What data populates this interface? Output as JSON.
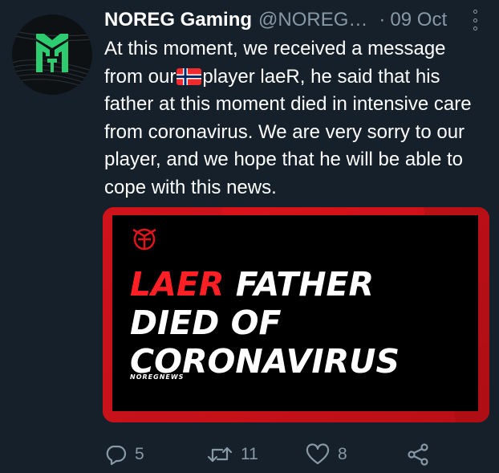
{
  "tweet": {
    "author_name": "NOREG Gaming",
    "handle": "@NOREG…",
    "separator": "·",
    "date": "09 Oct",
    "text_before_flag": "At this moment, we received a message from our",
    "flag_icon": "norway-flag-icon",
    "text_after_flag": "player laeR, he said that his father at this moment died in intensive care from coronavirus. We are very sorry to our player, and we hope that he will be able to cope with this news."
  },
  "media": {
    "headline_red": "LAER",
    "headline_line1": "FATHER",
    "headline_line2": "DIED OF",
    "headline_line3": "CORONAVIRUS",
    "tag": "NOREGNEWS"
  },
  "actions": {
    "reply_count": "5",
    "retweet_count": "11",
    "like_count": "8"
  },
  "icons": {
    "reply": "reply-icon",
    "retweet": "retweet-icon",
    "like": "heart-icon",
    "share": "share-icon",
    "more": "more-options-icon"
  },
  "colors": {
    "background": "#15202b",
    "secondary_text": "#8899a6",
    "brand_green": "#2ecc71",
    "media_red": "#e0141c"
  }
}
